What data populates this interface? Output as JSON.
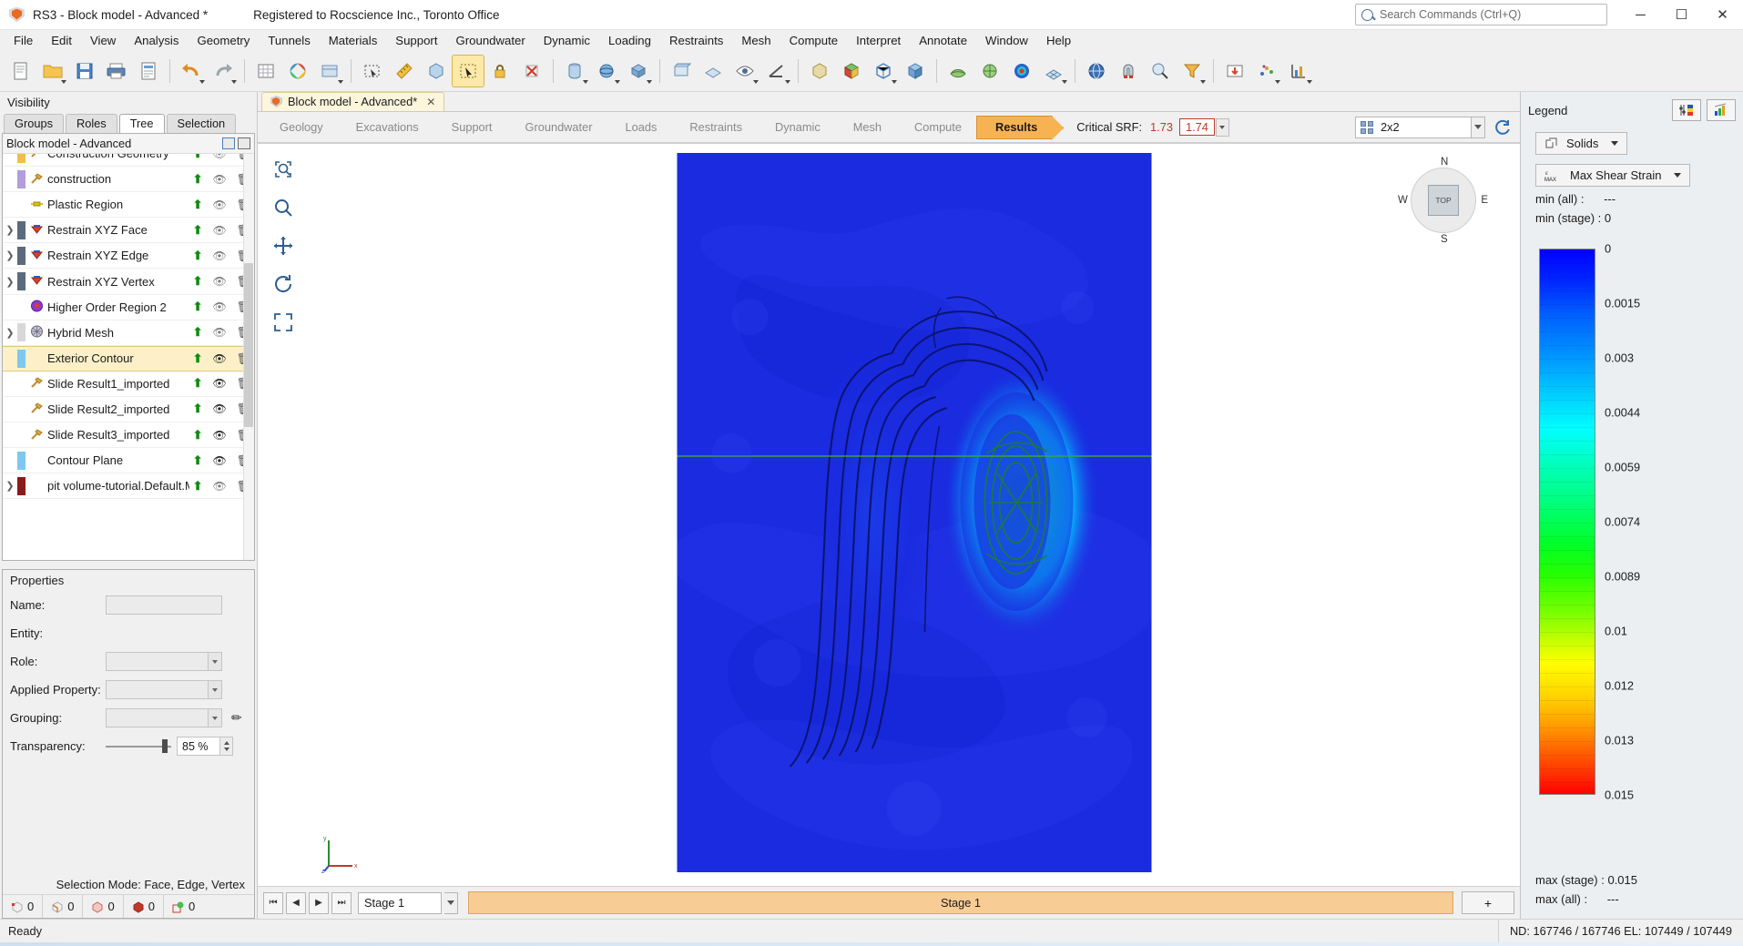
{
  "titlebar": {
    "app_icon": "rocscience-shield-icon",
    "title": "RS3 - Block model - Advanced *",
    "registration": "Registered to Rocscience Inc., Toronto Office",
    "search_placeholder": "Search Commands (Ctrl+Q)",
    "minimize": "─",
    "maximize": "☐",
    "close": "✕"
  },
  "menubar": {
    "items": [
      "File",
      "Edit",
      "View",
      "Analysis",
      "Geometry",
      "Tunnels",
      "Materials",
      "Support",
      "Groundwater",
      "Dynamic",
      "Loading",
      "Restraints",
      "Mesh",
      "Compute",
      "Interpret",
      "Annotate",
      "Window",
      "Help"
    ]
  },
  "toolbar": {
    "groups": [
      [
        "new-document",
        "open-folder",
        "save",
        "print",
        "page-setup"
      ],
      [
        "undo",
        "redo"
      ],
      [
        "grid-settings",
        "color-palette",
        "display-options"
      ],
      [
        "select-box",
        "measure-ruler",
        "snap-cube",
        "project-settings"
      ],
      [
        "select-arrow",
        "pan-lock",
        "delete-selection"
      ],
      [
        "solid-cylinder",
        "sphere-primitive",
        "extrude-shape"
      ],
      [
        "view-front",
        "view-plane",
        "view-eye",
        "view-angle"
      ],
      [
        "box-volume",
        "cube-materials",
        "cube-wire",
        "cube-solid"
      ],
      [
        "mesh-surface",
        "mesh-sphere",
        "contour-plot",
        "mesh-grid",
        "globe-view"
      ],
      [
        "magnet-tool",
        "probe-tool",
        "funnel-filter"
      ],
      [
        "export-data",
        "scatter-points",
        "axis-chart"
      ]
    ]
  },
  "left_panel": {
    "panel_title": "Visibility",
    "tabs": [
      {
        "label": "Groups",
        "active": false
      },
      {
        "label": "Roles",
        "active": false
      },
      {
        "label": "Tree",
        "active": true
      },
      {
        "label": "Selection",
        "active": false
      }
    ],
    "tree_header": "Block model - Advanced",
    "tree_items": [
      {
        "label": "Construction Geometry",
        "indent": 1,
        "expandable": false,
        "swatch": "#f0c040",
        "icon": "geometry-icon",
        "visible": false,
        "pinned": true,
        "selected": false,
        "partial": true
      },
      {
        "label": "construction",
        "indent": 1,
        "expandable": false,
        "swatch": "#b39ddb",
        "icon": "hammer-icon",
        "visible": false,
        "pinned": true,
        "selected": false
      },
      {
        "label": "Plastic Region",
        "indent": 1,
        "expandable": false,
        "swatch": "",
        "icon": "plastic-region-icon",
        "visible": false,
        "pinned": true,
        "selected": false
      },
      {
        "label": "Restrain XYZ Face",
        "indent": 0,
        "expandable": true,
        "swatch": "#5b6b7b",
        "icon": "restraint-icon",
        "visible": false,
        "pinned": true,
        "selected": false
      },
      {
        "label": "Restrain XYZ Edge",
        "indent": 0,
        "expandable": true,
        "swatch": "#5b6b7b",
        "icon": "restraint-icon",
        "visible": false,
        "pinned": true,
        "selected": false
      },
      {
        "label": "Restrain XYZ Vertex",
        "indent": 0,
        "expandable": true,
        "swatch": "#5b6b7b",
        "icon": "restraint-icon",
        "visible": false,
        "pinned": true,
        "selected": false
      },
      {
        "label": "Higher Order Region 2",
        "indent": 1,
        "expandable": false,
        "swatch": "",
        "icon": "higher-order-region-icon",
        "visible": false,
        "pinned": true,
        "selected": false
      },
      {
        "label": "Hybrid Mesh",
        "indent": 0,
        "expandable": true,
        "swatch": "#d8d8d8",
        "icon": "mesh-ball-icon",
        "visible": false,
        "pinned": true,
        "selected": false
      },
      {
        "label": "Exterior Contour",
        "indent": 1,
        "expandable": false,
        "swatch": "#7ec8f0",
        "icon": "",
        "visible": true,
        "pinned": true,
        "selected": true
      },
      {
        "label": "Slide Result1_imported",
        "indent": 1,
        "expandable": false,
        "swatch": "",
        "icon": "hammer-icon",
        "visible": true,
        "pinned": true,
        "selected": false
      },
      {
        "label": "Slide Result2_imported",
        "indent": 1,
        "expandable": false,
        "swatch": "",
        "icon": "hammer-icon",
        "visible": true,
        "pinned": true,
        "selected": false
      },
      {
        "label": "Slide Result3_imported",
        "indent": 1,
        "expandable": false,
        "swatch": "",
        "icon": "hammer-icon",
        "visible": true,
        "pinned": true,
        "selected": false
      },
      {
        "label": "Contour Plane",
        "indent": 1,
        "expandable": false,
        "swatch": "#7ec8f0",
        "icon": "",
        "visible": true,
        "pinned": true,
        "selected": false
      },
      {
        "label": "pit volume-tutorial.Default.M",
        "indent": 0,
        "expandable": true,
        "swatch": "#8b1a1a",
        "icon": "",
        "visible": false,
        "pinned": true,
        "selected": false
      }
    ],
    "properties": {
      "title": "Properties",
      "fields": [
        {
          "label": "Name:",
          "value": "",
          "type": "text"
        },
        {
          "label": "Entity:",
          "value": "",
          "type": "static"
        },
        {
          "label": "Role:",
          "value": "",
          "type": "combo"
        },
        {
          "label": "Applied Property:",
          "value": "",
          "type": "combo"
        },
        {
          "label": "Grouping:",
          "value": "",
          "type": "combo-pencil"
        }
      ],
      "transparency": {
        "label": "Transparency:",
        "value": "85 %"
      }
    },
    "selection_mode": "Selection Mode: Face, Edge, Vertex",
    "counters": [
      {
        "icon": "vertex-count-icon",
        "value": "0"
      },
      {
        "icon": "edge-count-icon",
        "value": "0"
      },
      {
        "icon": "face-count-icon",
        "value": "0"
      },
      {
        "icon": "solid-count-icon",
        "value": "0"
      },
      {
        "icon": "group-count-icon",
        "value": "0"
      }
    ]
  },
  "center": {
    "document_tab": {
      "label": "Block model - Advanced*",
      "close": "✕"
    },
    "workflow_tabs": [
      {
        "label": "Geology",
        "active": false
      },
      {
        "label": "Excavations",
        "active": false
      },
      {
        "label": "Support",
        "active": false
      },
      {
        "label": "Groundwater",
        "active": false
      },
      {
        "label": "Loads",
        "active": false
      },
      {
        "label": "Restraints",
        "active": false
      },
      {
        "label": "Dynamic",
        "active": false
      },
      {
        "label": "Mesh",
        "active": false
      },
      {
        "label": "Compute",
        "active": false
      },
      {
        "label": "Results",
        "active": true
      }
    ],
    "critical_srf": {
      "label": "Critical SRF:",
      "value_prev": "1.73",
      "value_current": "1.74"
    },
    "layout_select": {
      "value": "2x2",
      "icon": "grid-2x2-icon"
    },
    "refresh_icon": "refresh-icon",
    "view_tools": [
      "zoom-window-icon",
      "zoom-icon",
      "pan-icon",
      "rotate-icon",
      "zoom-extents-icon"
    ],
    "nav_cube": {
      "face": "TOP",
      "north": "N",
      "south": "S",
      "east": "E",
      "west": "W"
    },
    "axis_triad": {
      "x": "x",
      "y": "y",
      "z": "z"
    },
    "stage_bar": {
      "first": "⏮",
      "prev": "◀",
      "next": "▶",
      "last": "⏭",
      "stage_value": "Stage 1",
      "strip_label": "Stage 1",
      "add_label": "+"
    }
  },
  "legend": {
    "title": "Legend",
    "buttons": [
      "legend-settings-icon",
      "contour-options-icon"
    ],
    "mode_select": {
      "label": "Solids",
      "icon": "solids-icon"
    },
    "result_select": {
      "label": "Max Shear Strain",
      "icon": "epsilon-max-icon"
    },
    "min_all_label": "min (all) :",
    "min_all_value": "---",
    "min_stage_label": "min (stage) : 0",
    "max_stage_label": "max (stage) : 0.015",
    "max_all_label": "max (all) :",
    "max_all_value": "---",
    "ticks": [
      "0",
      "0.0015",
      "0.003",
      "0.0044",
      "0.0059",
      "0.0074",
      "0.0089",
      "0.01",
      "0.012",
      "0.013",
      "0.015"
    ]
  },
  "statusbar": {
    "ready": "Ready",
    "node_element": "ND: 167746 / 167746  EL: 107449 / 107449"
  },
  "colors": {
    "accent_orange": "#f7b352",
    "selection_yellow": "#fdf0c8",
    "srf_red": "#c0392b",
    "legend_min": "#0000ff",
    "legend_max": "#ff0000",
    "render_bg": "#1a2be0"
  }
}
